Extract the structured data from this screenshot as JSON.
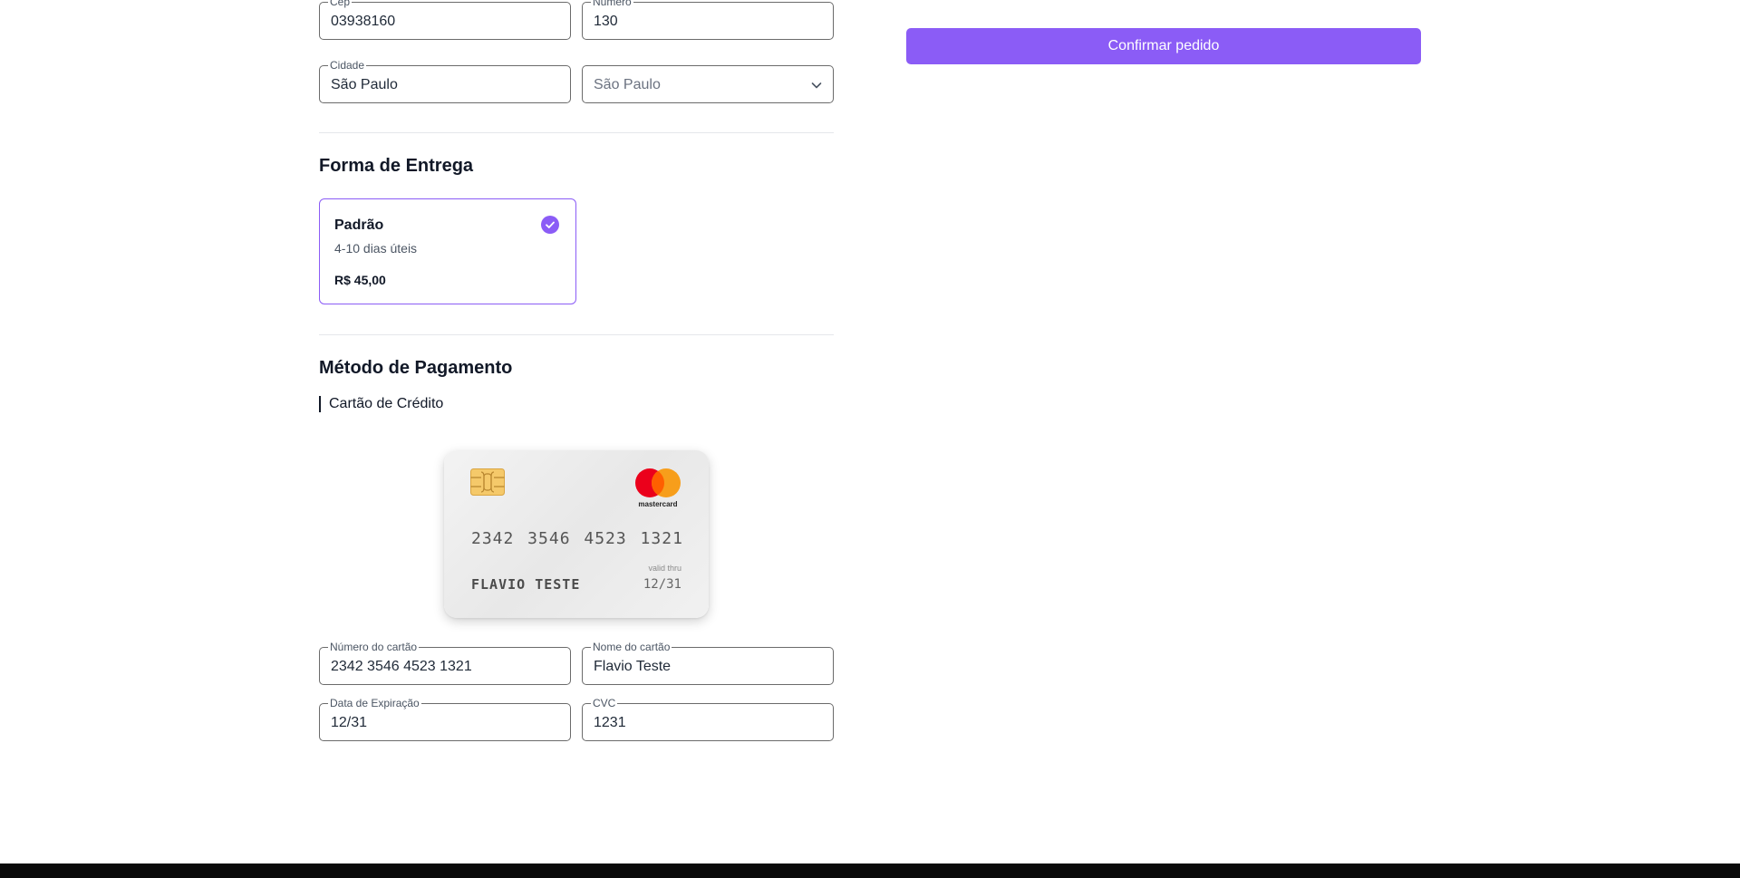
{
  "address": {
    "cep": {
      "label": "Cep",
      "value": "03938160"
    },
    "numero": {
      "label": "Número",
      "value": "130"
    },
    "cidade": {
      "label": "Cidade",
      "value": "São Paulo"
    },
    "estado": {
      "value": "São Paulo"
    }
  },
  "shipping": {
    "title": "Forma de Entrega",
    "option": {
      "name": "Padrão",
      "days": "4-10 dias úteis",
      "price": "R$ 45,00",
      "selected": true
    }
  },
  "payment": {
    "title": "Método de Pagamento",
    "method": "Cartão de Crédito",
    "card_preview": {
      "number": "2342 3546 4523 1321",
      "holder": "FLAVIO TESTE",
      "valid_label": "valid thru",
      "expiry": "12/31",
      "brand": "mastercard"
    },
    "fields": {
      "card_number": {
        "label": "Número do cartão",
        "value": "2342 3546 4523 1321"
      },
      "card_name": {
        "label": "Nome do cartão",
        "value": "Flavio Teste"
      },
      "expiry": {
        "label": "Data de Expiração",
        "value": "12/31"
      },
      "cvc": {
        "label": "CVC",
        "value": "1231"
      }
    }
  },
  "summary": {
    "confirm_label": "Confirmar pedido"
  },
  "colors": {
    "accent": "#8b5cf6",
    "footer": "#0a0a0a",
    "mastercard_red": "#eb001b",
    "mastercard_orange": "#f79e1b"
  },
  "icons": {
    "select_arrow": "chevron-down-icon",
    "selected": "check-circle-icon",
    "chip": "card-chip-icon",
    "brand": "mastercard-logo"
  }
}
